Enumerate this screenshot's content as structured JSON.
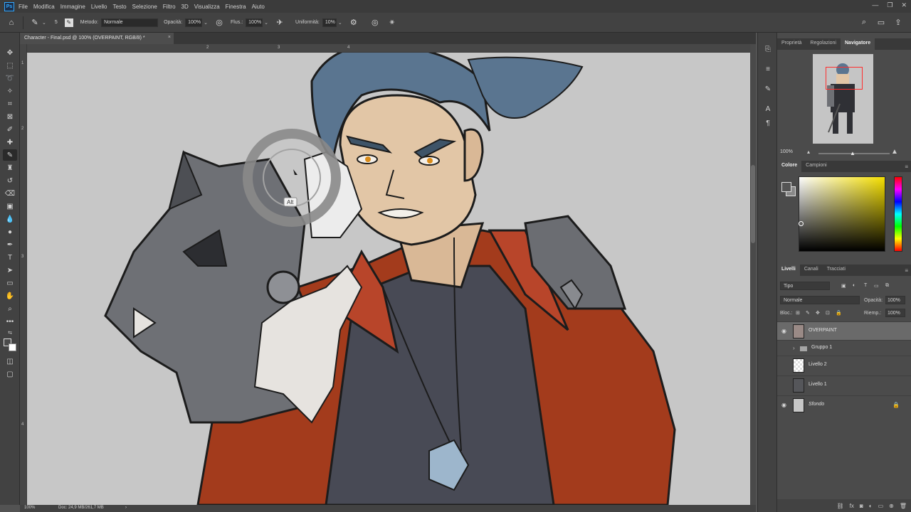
{
  "app": {
    "logo": "Ps"
  },
  "menu": [
    "File",
    "Modifica",
    "Immagine",
    "Livello",
    "Testo",
    "Selezione",
    "Filtro",
    "3D",
    "Visualizza",
    "Finestra",
    "Aiuto"
  ],
  "options": {
    "brush_size": "5",
    "method_label": "Metodo:",
    "method_value": "Normale",
    "opacity_label": "Opacità:",
    "opacity_value": "100%",
    "flow_label": "Flus.:",
    "flow_value": "100%",
    "uniformity_label": "Uniformità:",
    "uniformity_value": "10%"
  },
  "document": {
    "tab_title": "Character - Final.psd @ 100% (OVERPAINT, RGB/8) *",
    "close_glyph": "×",
    "ruler_marks": [
      "2",
      "3",
      "4"
    ],
    "ruler_v_marks": [
      "1",
      "2",
      "3",
      "4"
    ],
    "brush_tooltip": "Alt"
  },
  "status": {
    "zoom": "100%",
    "doc_info": "Doc: 24,9 MB/261,7 MB"
  },
  "panels": {
    "top_tabs": [
      "Proprietà",
      "Regolazioni",
      "Navigatore"
    ],
    "navigator_zoom": "100%",
    "color_tabs": [
      "Colore",
      "Campioni"
    ],
    "layers_tabs": [
      "Livelli",
      "Canali",
      "Tracciati"
    ],
    "layers_filter": "Tipo",
    "blend_mode": "Normale",
    "opacity_label": "Opacità:",
    "opacity_value": "100%",
    "lock_label": "Bloc.:",
    "fill_label": "Riemp.:",
    "fill_value": "100%",
    "layers": [
      {
        "name": "OVERPAINT",
        "visible": true,
        "selected": true
      },
      {
        "name": "Gruppo 1",
        "visible": false,
        "group": true
      },
      {
        "name": "Livello 2",
        "visible": false
      },
      {
        "name": "Livello 1",
        "visible": false
      },
      {
        "name": "Sfondo",
        "visible": true,
        "locked": true
      }
    ]
  },
  "colors": {
    "hair": "#5a7590",
    "jacket": "#a33b1c",
    "armor": "#6b6d72",
    "skin": "#e2c6a6",
    "shirt": "#484a55",
    "fur": "#e6e3df",
    "canvas_bg": "#c7c7c7",
    "accent_nav": "#ff2e2e"
  },
  "icons": [
    "home-icon",
    "brush-icon",
    "airbrush-icon",
    "smoothing-icon",
    "gear-icon",
    "pressure-icon",
    "search-icon",
    "workspace-icon",
    "share-icon"
  ]
}
